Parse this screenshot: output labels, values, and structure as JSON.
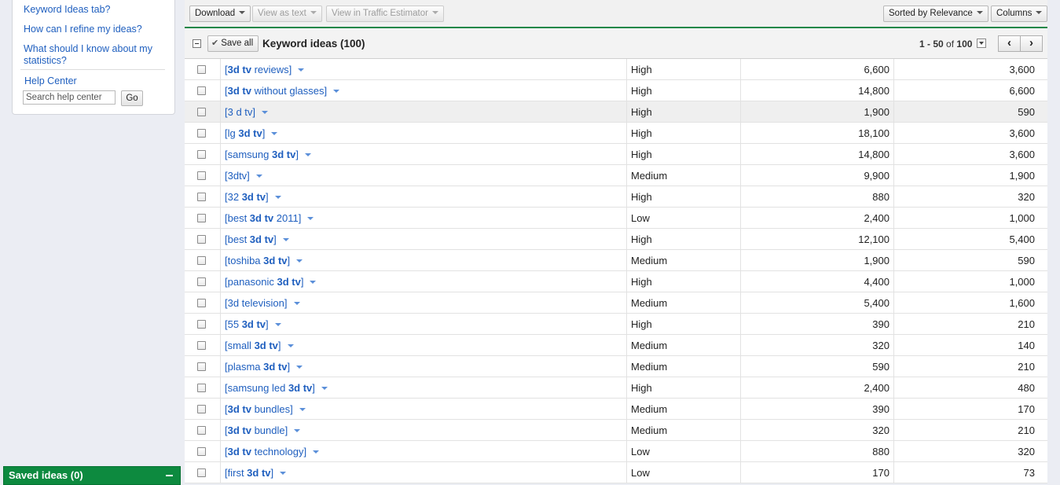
{
  "help": {
    "links": [
      "Keyword Ideas tab?",
      "How can I refine my ideas?",
      "What should I know about my",
      "statistics?"
    ],
    "help_center": "Help Center",
    "search_placeholder": "Search help center",
    "go_label": "Go"
  },
  "saved_ideas": {
    "label": "Saved ideas (0)"
  },
  "toolbar": {
    "download": "Download",
    "view_as_text": "View as text",
    "view_traffic": "View in Traffic Estimator",
    "sorted_by": "Sorted by Relevance",
    "columns": "Columns"
  },
  "header": {
    "save_all": "Save all",
    "title": "Keyword ideas (100)",
    "pager_range": "1 - 50",
    "pager_of": "of",
    "pager_total": "100",
    "prev": "‹",
    "next": "›"
  },
  "rows": [
    {
      "pre": "[",
      "bold": "3d tv",
      "post": " reviews]",
      "comp": "High",
      "global": "6,600",
      "local": "3,600"
    },
    {
      "pre": "[",
      "bold": "3d tv",
      "post": " without glasses]",
      "comp": "High",
      "global": "14,800",
      "local": "6,600"
    },
    {
      "pre": "[3 d tv]",
      "bold": "",
      "post": "",
      "comp": "High",
      "global": "1,900",
      "local": "590"
    },
    {
      "pre": "[lg ",
      "bold": "3d tv",
      "post": "]",
      "comp": "High",
      "global": "18,100",
      "local": "3,600"
    },
    {
      "pre": "[samsung ",
      "bold": "3d tv",
      "post": "]",
      "comp": "High",
      "global": "14,800",
      "local": "3,600"
    },
    {
      "pre": "[3dtv]",
      "bold": "",
      "post": "",
      "comp": "Medium",
      "global": "9,900",
      "local": "1,900"
    },
    {
      "pre": "[32 ",
      "bold": "3d tv",
      "post": "]",
      "comp": "High",
      "global": "880",
      "local": "320"
    },
    {
      "pre": "[best ",
      "bold": "3d tv",
      "post": " 2011]",
      "comp": "Low",
      "global": "2,400",
      "local": "1,000"
    },
    {
      "pre": "[best ",
      "bold": "3d tv",
      "post": "]",
      "comp": "High",
      "global": "12,100",
      "local": "5,400"
    },
    {
      "pre": "[toshiba ",
      "bold": "3d tv",
      "post": "]",
      "comp": "Medium",
      "global": "1,900",
      "local": "590"
    },
    {
      "pre": "[panasonic ",
      "bold": "3d tv",
      "post": "]",
      "comp": "High",
      "global": "4,400",
      "local": "1,000"
    },
    {
      "pre": "[3d television]",
      "bold": "",
      "post": "",
      "comp": "Medium",
      "global": "5,400",
      "local": "1,600"
    },
    {
      "pre": "[55 ",
      "bold": "3d tv",
      "post": "]",
      "comp": "High",
      "global": "390",
      "local": "210"
    },
    {
      "pre": "[small ",
      "bold": "3d tv",
      "post": "]",
      "comp": "Medium",
      "global": "320",
      "local": "140"
    },
    {
      "pre": "[plasma ",
      "bold": "3d tv",
      "post": "]",
      "comp": "Medium",
      "global": "590",
      "local": "210"
    },
    {
      "pre": "[samsung led ",
      "bold": "3d tv",
      "post": "]",
      "comp": "High",
      "global": "2,400",
      "local": "480"
    },
    {
      "pre": "[",
      "bold": "3d tv",
      "post": " bundles]",
      "comp": "Medium",
      "global": "390",
      "local": "170"
    },
    {
      "pre": "[",
      "bold": "3d tv",
      "post": " bundle]",
      "comp": "Medium",
      "global": "320",
      "local": "210"
    },
    {
      "pre": "[",
      "bold": "3d tv",
      "post": " technology]",
      "comp": "Low",
      "global": "880",
      "local": "320"
    },
    {
      "pre": "[first ",
      "bold": "3d tv",
      "post": "]",
      "comp": "Low",
      "global": "170",
      "local": "73"
    }
  ]
}
